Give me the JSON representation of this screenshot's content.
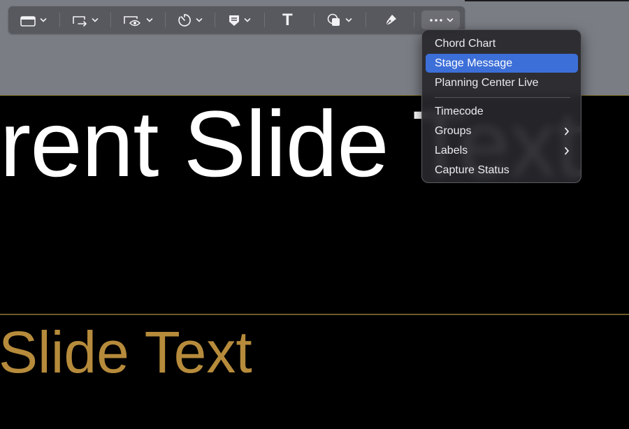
{
  "toolbar": {
    "items": [
      {
        "icon": "screen-layout-icon",
        "has_dropdown": true
      },
      {
        "icon": "screen-swap-icon",
        "has_dropdown": true
      },
      {
        "icon": "preview-eye-icon",
        "has_dropdown": true
      },
      {
        "icon": "timer-icon",
        "has_dropdown": true
      },
      {
        "icon": "marker-icon",
        "has_dropdown": true
      },
      {
        "icon": "text-tool-icon",
        "glyph": "T",
        "has_dropdown": false
      },
      {
        "icon": "shapes-icon",
        "has_dropdown": true
      },
      {
        "icon": "pen-tool-icon",
        "has_dropdown": false
      },
      {
        "icon": "more-icon",
        "has_dropdown": true
      }
    ]
  },
  "stage": {
    "current_slide_text": "rrent Slide Text",
    "next_slide_text": "Slide Text"
  },
  "menu": {
    "items": [
      {
        "label": "Chord Chart"
      },
      {
        "label": "Stage Message",
        "selected": true
      },
      {
        "label": "Planning Center Live"
      },
      {
        "label": "Timecode"
      },
      {
        "label": "Groups",
        "submenu": true
      },
      {
        "label": "Labels",
        "submenu": true
      },
      {
        "label": "Capture Status"
      }
    ]
  },
  "colors": {
    "workspace": "#7a7d84",
    "toolbar": "#58595e",
    "menu_highlight": "#3d6fd8",
    "next_slide_text": "#b68b3b",
    "current_slide_text": "#ffffff",
    "stage_background": "#000000"
  }
}
